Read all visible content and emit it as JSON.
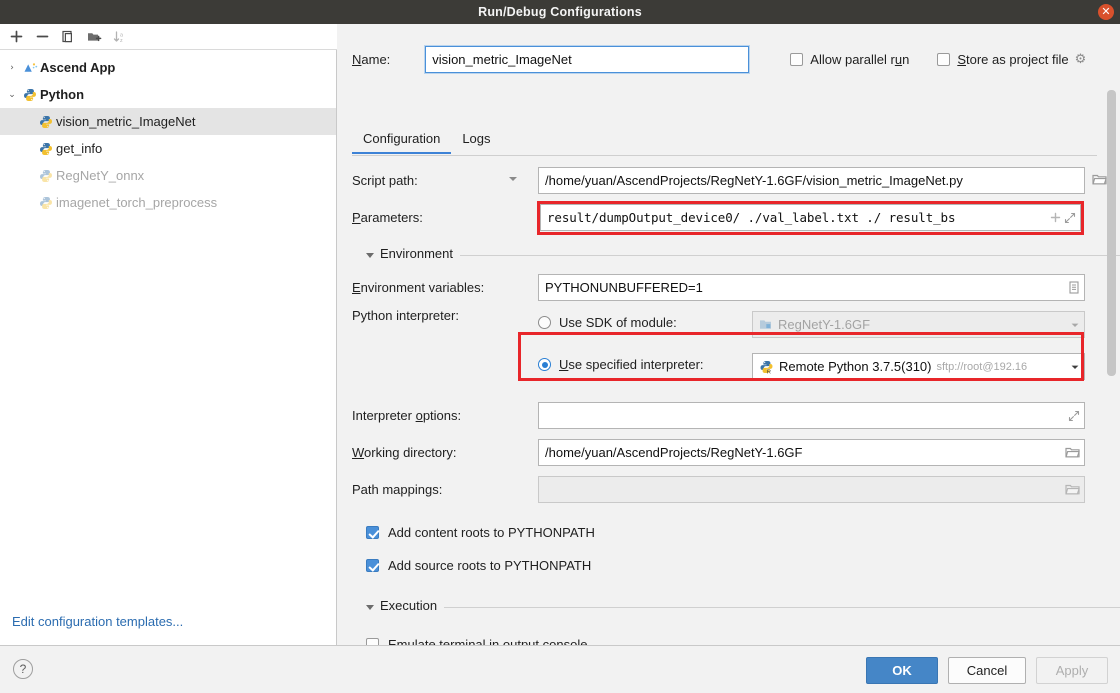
{
  "window": {
    "title": "Run/Debug Configurations",
    "close_icon": "close-icon"
  },
  "sidebar": {
    "toolbar": [
      {
        "name": "add-configuration",
        "icon": "plus-icon",
        "enabled": true
      },
      {
        "name": "remove-configuration",
        "icon": "minus-icon",
        "enabled": true
      },
      {
        "name": "copy-configuration",
        "icon": "copy-icon",
        "enabled": true
      },
      {
        "name": "move-into-folder",
        "icon": "folder-add-icon",
        "enabled": true
      },
      {
        "name": "sort-configurations",
        "icon": "sort-alpha-icon",
        "enabled": false
      }
    ],
    "tree": [
      {
        "label": "Ascend App",
        "type": "group",
        "expanded": false,
        "twisty": "›",
        "icon": "ascend-app-icon",
        "dimmed": false,
        "selected": false
      },
      {
        "label": "Python",
        "type": "group",
        "expanded": true,
        "twisty": "⌄",
        "icon": "python-icon",
        "dimmed": false,
        "selected": false
      },
      {
        "label": "vision_metric_ImageNet",
        "type": "child",
        "icon": "python-file-icon",
        "dimmed": false,
        "selected": true
      },
      {
        "label": "get_info",
        "type": "child",
        "icon": "python-file-icon",
        "dimmed": false,
        "selected": false
      },
      {
        "label": "RegNetY_onnx",
        "type": "child",
        "icon": "python-file-icon",
        "dimmed": true,
        "selected": false
      },
      {
        "label": "imagenet_torch_preprocess",
        "type": "child",
        "icon": "python-file-icon",
        "dimmed": true,
        "selected": false
      }
    ],
    "edit_templates_link": "Edit configuration templates..."
  },
  "header": {
    "name_label": "Name:",
    "name_value": "vision_metric_ImageNet",
    "allow_parallel_run_label": "Allow parallel run",
    "allow_parallel_run_checked": false,
    "store_as_project_file_label": "Store as project file",
    "store_as_project_file_checked": false,
    "gear_icon": "gear-icon"
  },
  "tabs": [
    {
      "label": "Configuration",
      "active": true
    },
    {
      "label": "Logs",
      "active": false
    }
  ],
  "form": {
    "script_path": {
      "label": "Script path:",
      "value": "/home/yuan/AscendProjects/RegNetY-1.6GF/vision_metric_ImageNet.py",
      "browse_icon": "folder-icon",
      "dropdown_icon": "chevron-down-icon"
    },
    "parameters": {
      "label": "Parameters:",
      "value": "result/dumpOutput_device0/ ./val_label.txt ./ result_bs",
      "insert_icon": "plus-icon",
      "expand_icon": "expand-icon",
      "highlighted": true
    },
    "environment_section": "Environment",
    "environment_variables": {
      "label": "Environment variables:",
      "value": "PYTHONUNBUFFERED=1",
      "edit_icon": "list-edit-icon"
    },
    "python_interpreter": {
      "label": "Python interpreter:",
      "sdk_option_label": "Use SDK of module:",
      "sdk_option_selected": false,
      "sdk_module_value": "RegNetY-1.6GF",
      "sdk_module_icon": "module-icon",
      "specified_option_label": "Use specified interpreter:",
      "specified_option_selected": true,
      "specified_value": "Remote Python 3.7.5(310)",
      "specified_hint": "sftp://root@192.16",
      "specified_icon": "remote-python-icon",
      "highlighted": true
    },
    "interpreter_options": {
      "label": "Interpreter options:",
      "value": "",
      "expand_icon": "expand-icon"
    },
    "working_directory": {
      "label": "Working directory:",
      "value": "/home/yuan/AscendProjects/RegNetY-1.6GF",
      "browse_icon": "folder-icon"
    },
    "path_mappings": {
      "label": "Path mappings:",
      "value": "",
      "browse_icon": "folder-icon",
      "disabled": true
    },
    "add_content_roots": {
      "label": "Add content roots to PYTHONPATH",
      "checked": true
    },
    "add_source_roots": {
      "label": "Add source roots to PYTHONPATH",
      "checked": true
    },
    "execution_section": "Execution",
    "emulate_terminal": {
      "label": "Emulate terminal in output console",
      "checked": false
    }
  },
  "footer": {
    "help_label": "?",
    "ok_label": "OK",
    "cancel_label": "Cancel",
    "apply_label": "Apply",
    "apply_enabled": false
  },
  "colors": {
    "titlebar_bg": "#3c3b37",
    "accent_blue": "#4586c7",
    "highlight_red": "#e8262a",
    "link_blue": "#2b6cb0"
  }
}
